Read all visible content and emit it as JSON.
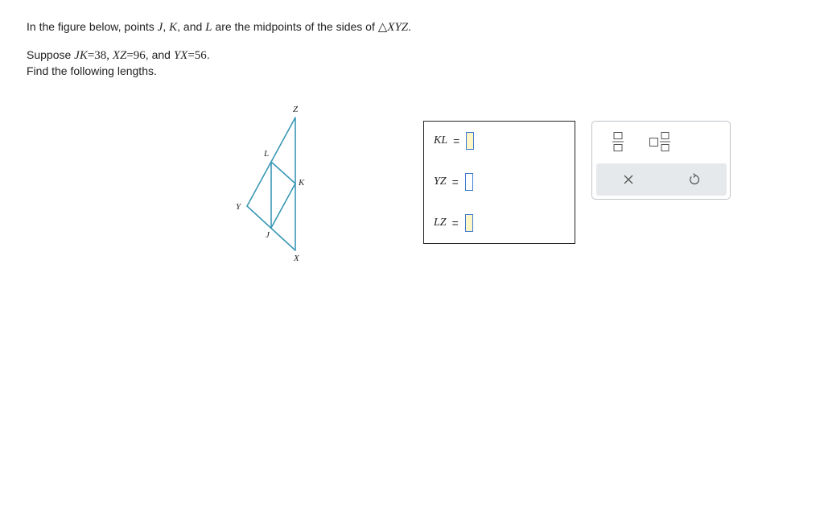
{
  "problem": {
    "line1": {
      "t1": "In the figure below, points ",
      "J": "J",
      "c1": ", ",
      "K": "K",
      "c2": ", and ",
      "L": "L",
      "t2": " are the midpoints of the sides of ",
      "triangle": "△",
      "XYZ": "XYZ",
      "end": "."
    },
    "line2": {
      "t1": "Suppose ",
      "JK": "JK",
      "eq1": "=38, ",
      "XZ": "XZ",
      "eq2": "=96",
      "t2": ", and ",
      "YX": "YX",
      "eq3": "=56",
      "end": "."
    },
    "line3": "Find the following lengths."
  },
  "figure": {
    "labels": {
      "Z": "Z",
      "L": "L",
      "K": "K",
      "Y": "Y",
      "J": "J",
      "X": "X"
    },
    "line_color": "#3a98b5"
  },
  "answers": [
    {
      "label": "KL",
      "equals": "=",
      "value": "",
      "state": "filled"
    },
    {
      "label": "YZ",
      "equals": "=",
      "value": "",
      "state": "empty"
    },
    {
      "label": "LZ",
      "equals": "=",
      "value": "",
      "state": "filled"
    }
  ],
  "toolbar": {
    "fraction_icon": "fraction-icon",
    "mixed_number_icon": "mixed-number-icon",
    "clear_icon": "close-icon",
    "clear_glyph": "×",
    "undo_icon": "undo-icon",
    "undo_glyph": "↺",
    "accent": "#3c7bd1"
  }
}
